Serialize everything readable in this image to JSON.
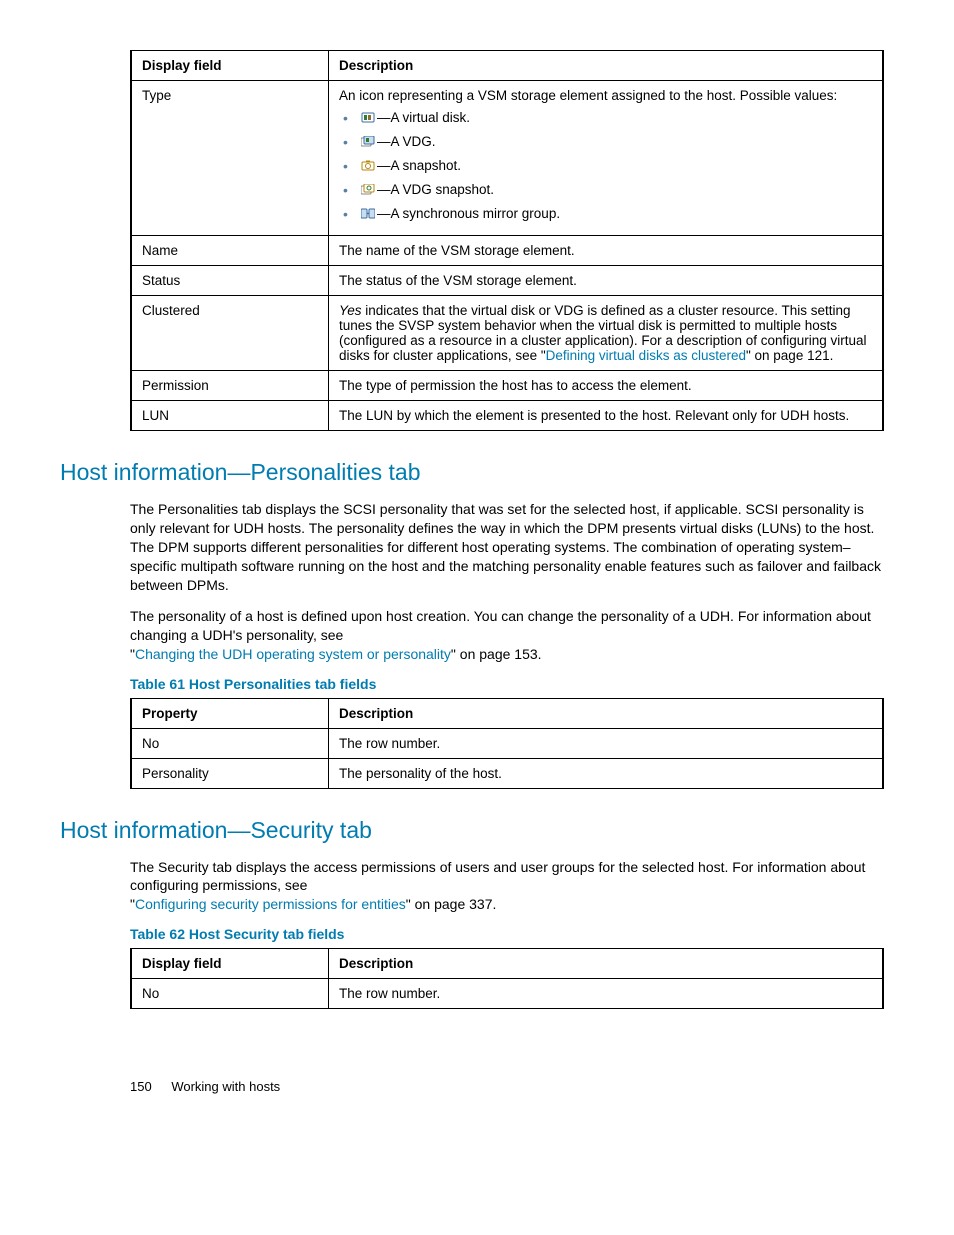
{
  "table1": {
    "header_field": "Display field",
    "header_desc": "Description",
    "type_label": "Type",
    "type_intro": "An icon representing a VSM storage element assigned to the host. Possible values:",
    "type_items": {
      "vdisk": "—A virtual disk.",
      "vdg": "—A VDG.",
      "snapshot": "—A snapshot.",
      "vdgsnap": "—A VDG snapshot.",
      "mirror": "—A synchronous mirror group."
    },
    "name_label": "Name",
    "name_desc": "The name of the VSM storage element.",
    "status_label": "Status",
    "status_desc": "The status of the VSM storage element.",
    "clustered_label": "Clustered",
    "clustered_yes": "Yes",
    "clustered_desc": " indicates that the virtual disk or VDG is defined as a cluster resource. This setting tunes the SVSP system behavior when the virtual disk is permitted to multiple hosts (configured as a resource in a cluster application). For a description of configuring virtual disks for cluster applications, see \"",
    "clustered_link": "Defining virtual disks as clustered",
    "clustered_tail": "\" on page 121.",
    "permission_label": "Permission",
    "permission_desc": "The type of permission the host has to access the element.",
    "lun_label": "LUN",
    "lun_desc": "The LUN by which the element is presented to the host. Relevant only for UDH hosts."
  },
  "section1": {
    "heading": "Host information—Personalities tab",
    "para1": "The Personalities tab displays the SCSI personality that was set for the selected host, if applicable. SCSI personality is only relevant for UDH hosts. The personality defines the way in which the DPM presents virtual disks (LUNs) to the host. The DPM supports different personalities for different host operating systems. The combination of operating system–specific multipath software running on the host and the matching personality enable features such as failover and failback between DPMs.",
    "para2_a": "The personality of a host is defined upon host creation. You can change the personality of a UDH. For information about changing a UDH's personality, see",
    "para2_link": "Changing the UDH operating system or personality",
    "para2_tail": "\" on page 153.",
    "table_caption": "Table 61 Host Personalities tab fields",
    "th_prop": "Property",
    "th_desc": "Description",
    "row_no_label": "No",
    "row_no_desc": "The row number.",
    "row_pers_label": "Personality",
    "row_pers_desc": "The personality of the host."
  },
  "section2": {
    "heading": "Host information—Security tab",
    "para1_a": "The Security tab displays the access permissions of users and user groups for the selected host. For information about configuring permissions, see",
    "para1_link": "Configuring security permissions for entities",
    "para1_tail": "\" on page 337.",
    "table_caption": "Table 62 Host Security tab fields",
    "th_field": "Display field",
    "th_desc": "Description",
    "row_no_label": "No",
    "row_no_desc": "The row number."
  },
  "footer": {
    "page": "150",
    "chapter": "Working with hosts"
  }
}
